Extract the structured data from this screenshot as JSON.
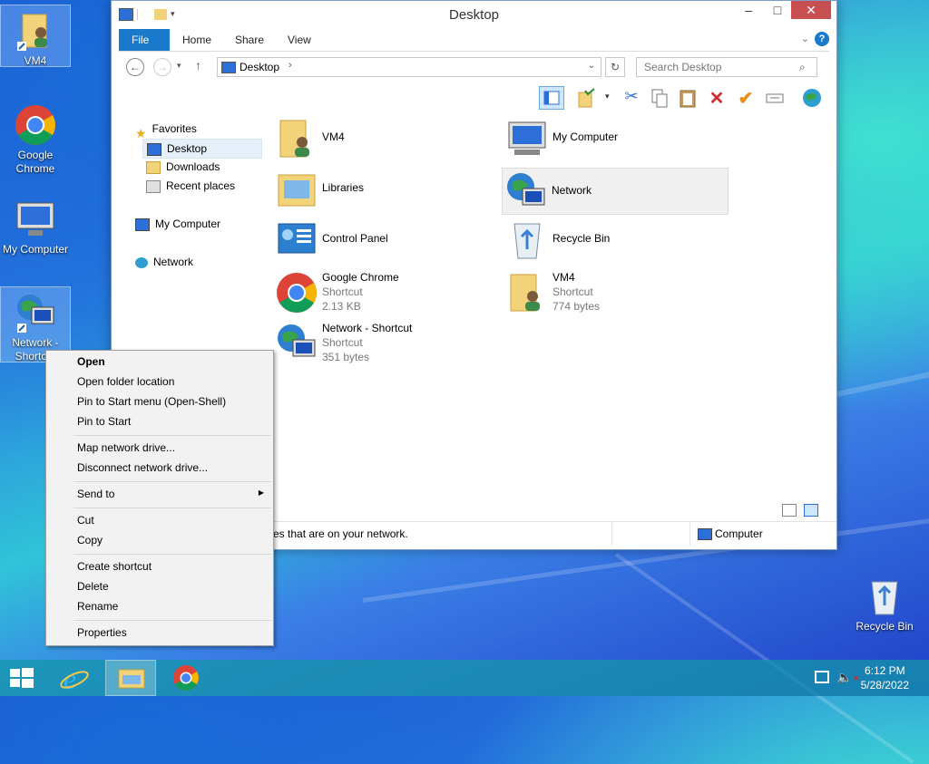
{
  "desktop": {
    "icons": [
      {
        "label": "VM4"
      },
      {
        "label": "Google Chrome"
      },
      {
        "label": "My Computer"
      },
      {
        "label": "Network - Shortcut"
      },
      {
        "label": "Recycle Bin"
      }
    ]
  },
  "window": {
    "title": "Desktop",
    "ribbon_tabs": [
      "File",
      "Home",
      "Share",
      "View"
    ],
    "address": {
      "path": "Desktop"
    },
    "search": {
      "placeholder": "Search Desktop"
    },
    "nav": {
      "favorites": "Favorites",
      "desktop": "Desktop",
      "downloads": "Downloads",
      "recent": "Recent places",
      "computer": "My Computer",
      "network": "Network"
    },
    "items": [
      {
        "name": "VM4"
      },
      {
        "name": "My Computer"
      },
      {
        "name": "Libraries"
      },
      {
        "name": "Network"
      },
      {
        "name": "Control Panel"
      },
      {
        "name": "Recycle Bin"
      },
      {
        "name": "Google Chrome",
        "type": "Shortcut",
        "size": "2.13 KB"
      },
      {
        "name": "VM4",
        "type": "Shortcut",
        "size": "774 bytes"
      },
      {
        "name": "Network - Shortcut",
        "type": "Shortcut",
        "size": "351 bytes"
      }
    ],
    "status": {
      "left": "es that are on your network.",
      "right": "Computer"
    }
  },
  "context_menu": {
    "items": [
      "Open",
      "Open folder location",
      "Pin to Start menu (Open-Shell)",
      "Pin to Start",
      "Map network drive...",
      "Disconnect network drive...",
      "Send to",
      "Cut",
      "Copy",
      "Create shortcut",
      "Delete",
      "Rename",
      "Properties"
    ]
  },
  "taskbar": {
    "time": "6:12 PM",
    "date": "5/28/2022"
  },
  "colors": {
    "file_tab": "#1979ca",
    "close_button": "#c74f4f",
    "selection": "#e5f0fb"
  }
}
